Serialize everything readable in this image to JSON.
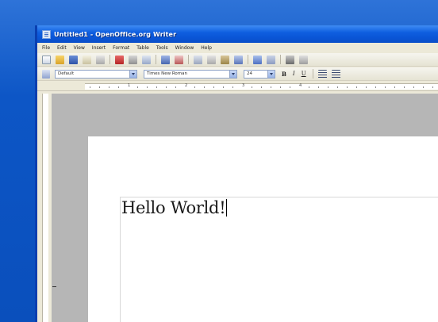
{
  "window": {
    "title": "Untitled1 - OpenOffice.org Writer"
  },
  "menu": [
    "File",
    "Edit",
    "View",
    "Insert",
    "Format",
    "Table",
    "Tools",
    "Window",
    "Help"
  ],
  "formatting": {
    "paragraph_style": "Default",
    "font_name": "Times New Roman",
    "font_size": "24",
    "bold_label": "B",
    "italic_label": "I",
    "underline_label": "U"
  },
  "ruler": {
    "numbers": [
      "1",
      "2",
      "3",
      "4"
    ]
  },
  "document": {
    "text": "Hello World!"
  },
  "colors": {
    "titlebar": "#0a55d6",
    "desktop": "#0c58c8",
    "chrome": "#ece9d8",
    "canvas": "#b6b6b6",
    "page": "#ffffff"
  }
}
